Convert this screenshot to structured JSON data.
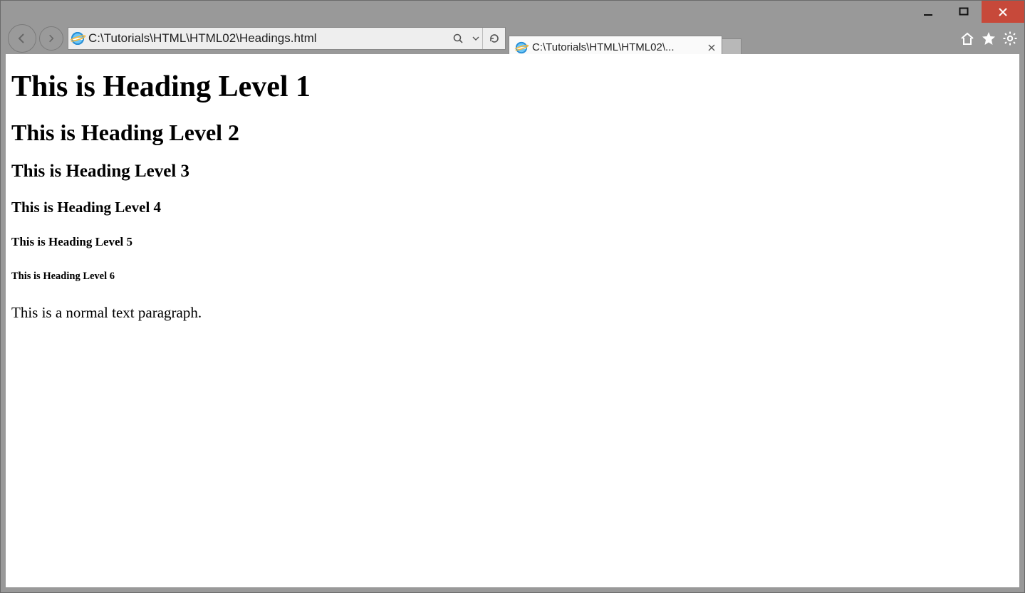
{
  "address": {
    "url": "C:\\Tutorials\\HTML\\HTML02\\Headings.html"
  },
  "tab": {
    "title": "C:\\Tutorials\\HTML\\HTML02\\..."
  },
  "content": {
    "h1": "This is Heading Level 1",
    "h2": "This is Heading Level 2",
    "h3": "This is Heading Level 3",
    "h4": "This is Heading Level 4",
    "h5": "This is Heading Level 5",
    "h6": "This is Heading Level 6",
    "p": "This is a normal text paragraph."
  }
}
